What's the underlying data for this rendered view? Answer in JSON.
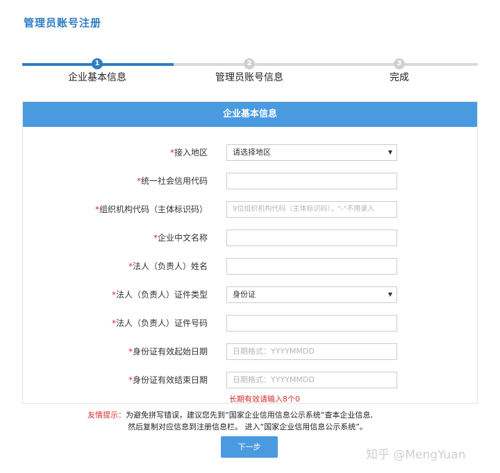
{
  "page": {
    "title": "管理员账号注册"
  },
  "steps": [
    {
      "num": "1",
      "label": "企业基本信息",
      "state": "active"
    },
    {
      "num": "2",
      "label": "管理员账号信息",
      "state": "inactive"
    },
    {
      "num": "3",
      "label": "完成",
      "state": "inactive"
    }
  ],
  "form": {
    "header": "企业基本信息",
    "required_mark": "*",
    "fields": [
      {
        "label": "接入地区",
        "required": true,
        "type": "select",
        "value": "请选择地区",
        "placeholder": ""
      },
      {
        "label": "统一社会信用代码",
        "required": true,
        "type": "input",
        "value": "",
        "placeholder": ""
      },
      {
        "label": "组织机构代码（主体标识码）",
        "required": true,
        "type": "input",
        "value": "",
        "placeholder": "9位组织机构代码（主体标识码），\"-\"不用录入"
      },
      {
        "label": "企业中文名称",
        "required": true,
        "type": "input",
        "value": "",
        "placeholder": ""
      },
      {
        "label": "法人（负责人）姓名",
        "required": true,
        "type": "input",
        "value": "",
        "placeholder": ""
      },
      {
        "label": "法人（负责人）证件类型",
        "required": true,
        "type": "select",
        "value": "身份证",
        "placeholder": ""
      },
      {
        "label": "法人（负责人）证件号码",
        "required": true,
        "type": "input",
        "value": "",
        "placeholder": ""
      },
      {
        "label": "身份证有效起始日期",
        "required": true,
        "type": "input",
        "value": "",
        "placeholder": "日期格式：YYYYMMDD"
      },
      {
        "label": "身份证有效结束日期",
        "required": true,
        "type": "input",
        "value": "",
        "placeholder": "日期格式：YYYYMMDD"
      }
    ],
    "long_term_hint": "长期有效请输入8个0"
  },
  "tip": {
    "label": "友情提示：",
    "line1": "为避免拼写错误，建议您先到“国家企业信用信息公示系统”查本企业信息,",
    "line2": "然后复制对应信息到注册信息栏。 进入“国家企业信用信息公示系统”。"
  },
  "next_button": "下一步",
  "watermark": "知乎 @MengYuan",
  "colors": {
    "accent": "#2e7dc6",
    "header": "#4a9ae0",
    "required": "#d62c2c"
  }
}
